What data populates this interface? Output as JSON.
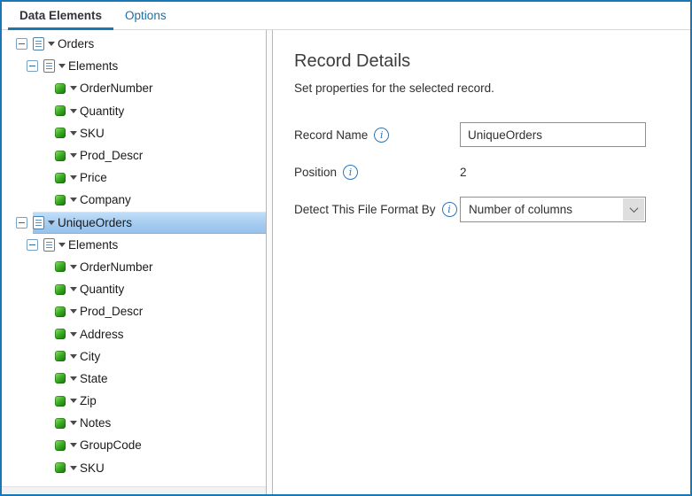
{
  "tabs": {
    "items": [
      {
        "label": "Data Elements",
        "active": true
      },
      {
        "label": "Options",
        "active": false
      }
    ]
  },
  "tree": {
    "items": [
      {
        "label": "Orders",
        "level": 0,
        "icon": "record",
        "expander": true
      },
      {
        "label": "Elements",
        "level": 1,
        "icon": "record",
        "expander": true
      },
      {
        "label": "OrderNumber",
        "level": 2,
        "icon": "field"
      },
      {
        "label": "Quantity",
        "level": 2,
        "icon": "field"
      },
      {
        "label": "SKU",
        "level": 2,
        "icon": "field"
      },
      {
        "label": "Prod_Descr",
        "level": 2,
        "icon": "field"
      },
      {
        "label": "Price",
        "level": 2,
        "icon": "field"
      },
      {
        "label": "Company",
        "level": 2,
        "icon": "field"
      },
      {
        "label": "UniqueOrders",
        "level": 0,
        "icon": "record",
        "expander": true,
        "selected": true
      },
      {
        "label": "Elements",
        "level": 1,
        "icon": "record",
        "expander": true
      },
      {
        "label": "OrderNumber",
        "level": 2,
        "icon": "field"
      },
      {
        "label": "Quantity",
        "level": 2,
        "icon": "field"
      },
      {
        "label": "Prod_Descr",
        "level": 2,
        "icon": "field"
      },
      {
        "label": "Address",
        "level": 2,
        "icon": "field"
      },
      {
        "label": "City",
        "level": 2,
        "icon": "field"
      },
      {
        "label": "State",
        "level": 2,
        "icon": "field"
      },
      {
        "label": "Zip",
        "level": 2,
        "icon": "field"
      },
      {
        "label": "Notes",
        "level": 2,
        "icon": "field"
      },
      {
        "label": "GroupCode",
        "level": 2,
        "icon": "field"
      },
      {
        "label": "SKU",
        "level": 2,
        "icon": "field"
      }
    ]
  },
  "details": {
    "title": "Record Details",
    "subtitle": "Set properties for the selected record.",
    "record_name": {
      "label": "Record Name",
      "value": "UniqueOrders"
    },
    "position": {
      "label": "Position",
      "value": "2"
    },
    "detect_format": {
      "label": "Detect This File Format By",
      "value": "Number of columns"
    }
  },
  "colors": {
    "accent_blue": "#1778b5",
    "link_blue": "#1d6fa5",
    "selection_top": "#bfdef9",
    "selection_bottom": "#96c2ec",
    "gem_green": "#3dae24",
    "info_blue": "#2e75b6"
  }
}
